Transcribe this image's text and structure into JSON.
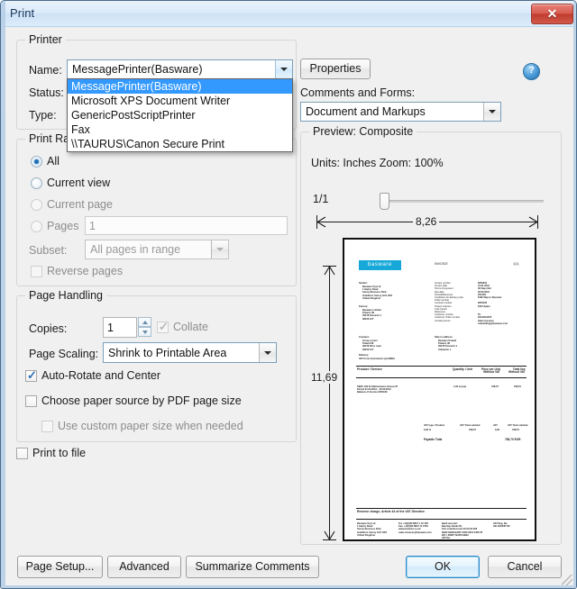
{
  "window": {
    "title": "Print",
    "close_label": "✕"
  },
  "printer": {
    "legend": "Printer",
    "name_label": "Name:",
    "status_label": "Status:",
    "type_label": "Type:",
    "selected_printer": "MessagePrinter(Basware)",
    "properties_button": "Properties",
    "help_icon": "?",
    "dropdown_options": [
      "MessagePrinter(Basware)",
      "Microsoft XPS Document Writer",
      "GenericPostScriptPrinter",
      "Fax",
      "\\\\TAURUS\\Canon Secure Print"
    ],
    "dropdown_selected_index": 0
  },
  "comments": {
    "label": "Comments and Forms:",
    "value": "Document and Markups"
  },
  "print_range": {
    "legend": "Print Range",
    "options": [
      {
        "label": "All",
        "checked": true,
        "disabled": false
      },
      {
        "label": "Current view",
        "checked": false,
        "disabled": false
      },
      {
        "label": "Current page",
        "checked": false,
        "disabled": true
      },
      {
        "label": "Pages",
        "checked": false,
        "disabled": true
      }
    ],
    "pages_value": "1",
    "subset_label": "Subset:",
    "subset_value": "All pages in range",
    "reverse_label": "Reverse pages",
    "reverse_checked": false
  },
  "page_handling": {
    "legend": "Page Handling",
    "copies_label": "Copies:",
    "copies_value": "1",
    "collate_label": "Collate",
    "collate_checked": true,
    "collate_disabled": true,
    "scaling_label": "Page Scaling:",
    "scaling_value": "Shrink to Printable Area",
    "auto_rotate_label": "Auto-Rotate and Center",
    "auto_rotate_checked": true,
    "paper_source_label": "Choose paper source by PDF page size",
    "paper_source_checked": false,
    "custom_paper_label": "Use custom paper size when needed",
    "custom_paper_checked": false,
    "custom_paper_disabled": true
  },
  "print_to_file": {
    "label": "Print to file",
    "checked": false
  },
  "preview": {
    "legend": "Preview: Composite",
    "units_line": "Units: Inches  Zoom: 100%",
    "page_counter": "1/1",
    "width_label": "8,26",
    "height_label": "11,69",
    "document": {
      "logo_text": "basware",
      "title_text": "INVOICE",
      "page_no": "1(1)",
      "sender_heading": "Sender:",
      "sender_lines": "Basware Oyj Ltd\n1 Harley Road\nSunny Business Park\nGuildford, Surrey GU1 1RX\nUnited Kingdom",
      "factory_heading": "Factory:",
      "factory_lines": "Basware Limited\nPoland, 08\n09178 Szczecin 1\n08156 017",
      "contract_heading": "Contract:",
      "contract_lines": "Group a level\nPoland 08\n09178 Silos road\n08156 017",
      "delivery_heading": "Delivery:",
      "delivery_lines": "VAT Form instruments (ph.9890)",
      "shipto_heading": "Ship to address:",
      "shipto_lines": "Basware Poland\nPoland, 08\n09178 Szczecin 1\nUnitedom 1",
      "meta_left": "Invoice number\nInvoice date\nTerms of payment\nDue date\nPeriod/Reference\nConditions for delivery price\nOrder number\nContract number\nProject order/no\nCost Center\nReference\nCustomer number\nCustomer Order number\nContact person",
      "meta_right": "9053031\n31.01.2013\n30 Days Net\n02.03.2013\n2013/01\nFOB Ship to Receiver\n\n9053135\n6413 Spain\n\n\nPL\n2013/019376\nSales Invoices\nsalesbilling@basware.com",
      "table_headers": [
        "Product / Service",
        "Quantity / Unit",
        "Price per Unit\nWithout VAT",
        "Total line\nWithout VAT"
      ],
      "line_item_desc": "SERV  109 E1 Maintenance licence IP\nPeriod 01.04.2013 – 30.03.2013\nBalance of Invoice 9053130",
      "line_item_qty": "1,00 ea (ea)",
      "line_item_price": "768,70",
      "line_item_total": "768,70",
      "vat_headers": [
        "VAT type / Position",
        "VAT Total subtotal",
        "VAT",
        "VAT Total subtotal"
      ],
      "vat_row": [
        "0,00 %",
        "768,70",
        "0,00",
        "768,70"
      ],
      "payable_label": "Payable Total",
      "payable_value": "768,70 EUR",
      "footer_note": "Reverse charge, Article 44 of the VAT Directive",
      "footer_cols": [
        "Basware Oyj Ltd\n1 Harley Road\nSunny Business Park\nGuildford, Surrey GU1 1RX\nUnited Kingdom",
        "Tel. +44(0)20 8847 1 12 456\nFax. +44(0)20 8847 11 0764\nwww.basware.co.uk\nsales.invoices@basware.com",
        "Bank account:\nBarclays Bank Plc\nSort code/Account 20-00-00 000\nIBAN GB00 BARC 2000 0012 3456 78\nBIC / SWIFT BARCGB22\nVAT No.\nGB000 1234 5678 0001",
        "VAT Reg. No.\nGB 1234567 89"
      ]
    }
  },
  "buttons": {
    "page_setup": "Page Setup...",
    "advanced": "Advanced",
    "summarize_comments": "Summarize Comments",
    "ok": "OK",
    "cancel": "Cancel"
  }
}
